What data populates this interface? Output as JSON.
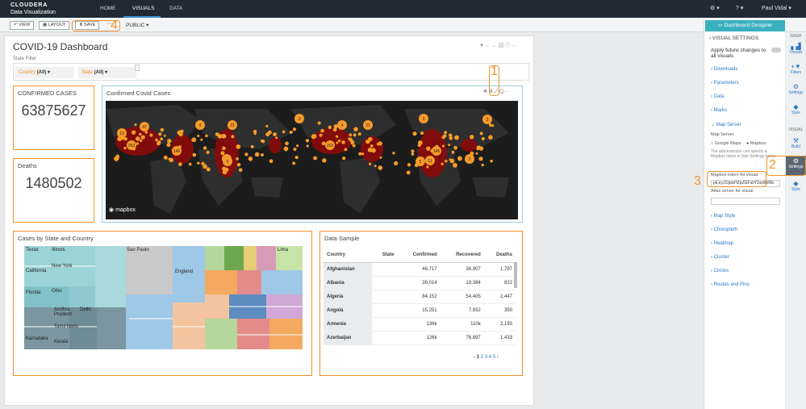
{
  "app": {
    "brand_line1": "CLOUDERA",
    "brand_line2": "Data Visualization"
  },
  "nav": {
    "items": [
      "HOME",
      "VISUALS",
      "DATA"
    ],
    "active": "VISUALS"
  },
  "topright": {
    "settings": "⚙ ▾",
    "help": "? ▾",
    "user": "Paul Vidal ▾"
  },
  "toolbar": {
    "view": "↶ VIEW",
    "layout": "▦ LAYOUT",
    "save": "⬆ SAVE",
    "more": "···",
    "public": "PUBLIC ▾"
  },
  "annotations": [
    "1",
    "2",
    "3",
    "4"
  ],
  "dashboard": {
    "title": "COVID-19 Dashboard",
    "filter_label": "State Filter",
    "filters": [
      {
        "name": "Country",
        "value": "(All) ▾"
      },
      {
        "name": "State",
        "value": "(All) ▾"
      }
    ]
  },
  "cards": {
    "confirmed_title": "CONFIRMED CASES",
    "confirmed_value": "63875627",
    "deaths_title": "Deaths",
    "deaths_value": "1480502"
  },
  "map": {
    "title": "Confirmed Covid Cases",
    "watermark": "mapbox",
    "cluster_labels": [
      "47",
      "4",
      "31",
      "3",
      "263",
      "146",
      "11",
      "5",
      "13",
      "2"
    ]
  },
  "treemap": {
    "title": "Cases by State and Country",
    "labels": [
      "Texas",
      "Illinois",
      "California",
      "New York",
      "Florida",
      "Ohio",
      "Andhra Pradesh",
      "Delhi",
      "Tamil Nadu",
      "Karnataka",
      "Kerala",
      "Sao Paulo",
      "England",
      "Lima"
    ]
  },
  "datasample": {
    "title": "Data Sample",
    "columns": [
      "Country",
      "State",
      "Confirmed",
      "Recovered",
      "Deaths"
    ],
    "rows": [
      [
        "Afghanistan",
        "",
        "46,717",
        "36,907",
        "1,797"
      ],
      [
        "Albania",
        "",
        "39,014",
        "19,384",
        "822"
      ],
      [
        "Algeria",
        "",
        "84,152",
        "54,405",
        "2,447"
      ],
      [
        "Angola",
        "",
        "15,251",
        "7,932",
        "350"
      ],
      [
        "Armenia",
        "",
        "136k",
        "110k",
        "2,193"
      ],
      [
        "Azerbaijan",
        "",
        "126k",
        "76,897",
        "1,433"
      ]
    ],
    "pages": [
      "‹",
      "1",
      "2",
      "3",
      "4",
      "5",
      "›"
    ]
  },
  "rightpanel": {
    "header": "Dashboard Designer",
    "visual_settings": "VISUAL SETTINGS",
    "apply_future": "Apply future changes to all visuals",
    "sections": [
      "Downloads",
      "Parameters",
      "Data",
      "Marks",
      "Map Server"
    ],
    "map_server_label": "Map Server",
    "opt_google": "Google Maps",
    "opt_mapbox": "Mapbox",
    "note": "The administrator can specify a Mapbox token in Site Settings below.",
    "token_label": "Mapbox token for visual",
    "token_value": "pk.eyJ1IjoicHZpZGFsIiY2xrdWRlc",
    "atlas_label": "Atlas server for visual",
    "sections2": [
      "Map Style",
      "Choropleth",
      "Heatmap",
      "Cluster",
      "Circles",
      "Routes and Pins"
    ]
  },
  "sidebar": {
    "dash": "DASH",
    "visual": "VISUAL",
    "items": [
      "Visuals",
      "Filters",
      "Settings",
      "Style"
    ],
    "items2": [
      "Build",
      "Settings",
      "Style"
    ]
  },
  "colors": {
    "accent": "#f0922c",
    "topbar": "#202a35",
    "teal": "#3ab0bf",
    "link": "#2a79c6"
  }
}
